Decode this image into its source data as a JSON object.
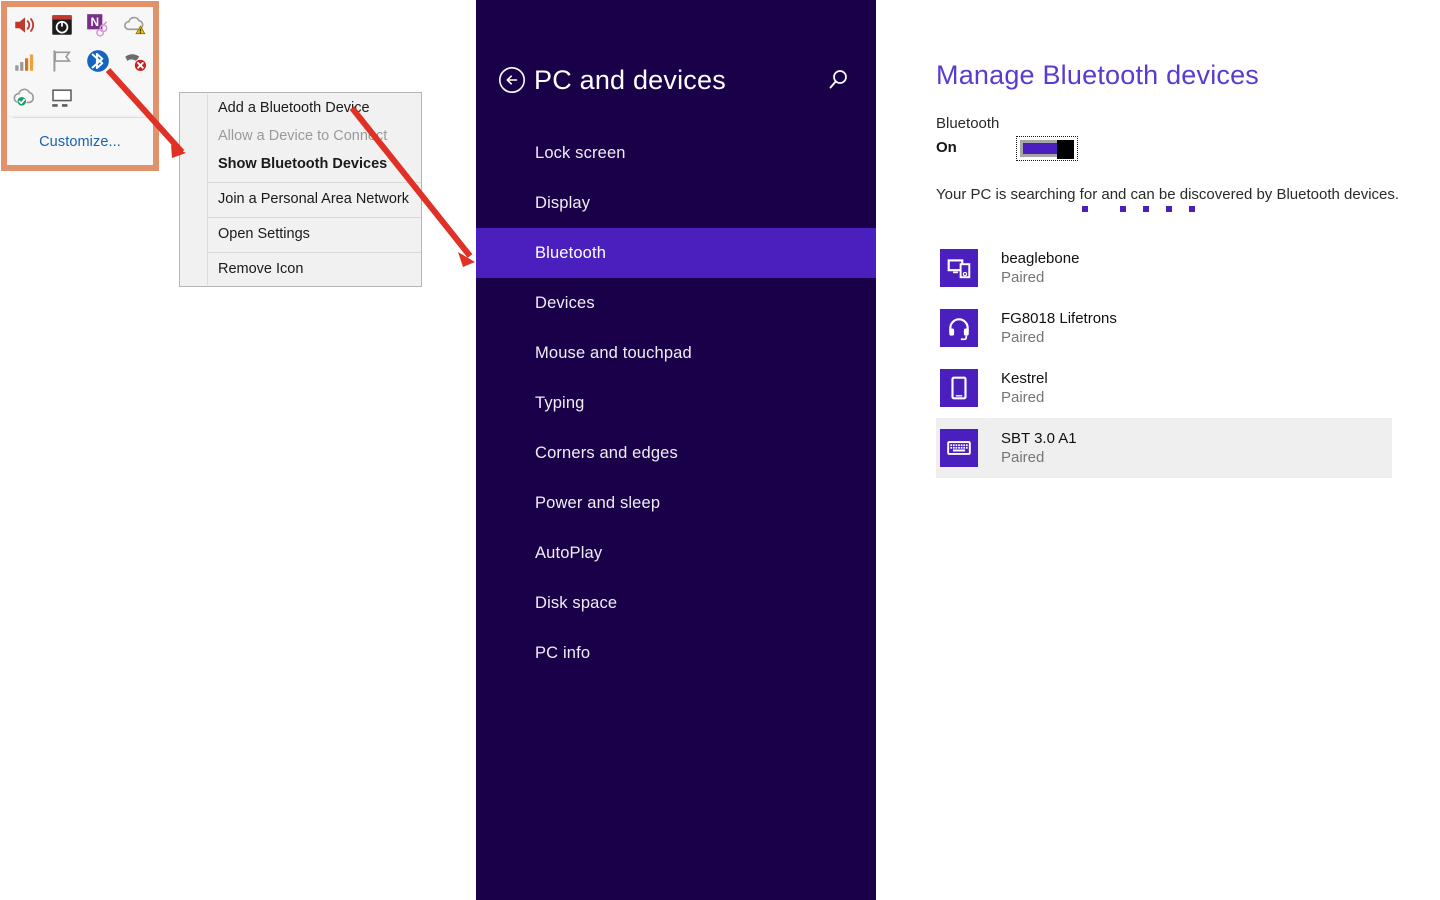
{
  "tray": {
    "icons": [
      {
        "name": "volume-icon",
        "label": "Volume"
      },
      {
        "name": "safely-remove-hardware-icon",
        "label": "Safely Remove Hardware"
      },
      {
        "name": "onenote-icon",
        "label": "OneNote"
      },
      {
        "name": "cloud-warning-icon",
        "label": "Cloud sync warning"
      },
      {
        "name": "network-signal-icon",
        "label": "Network signal"
      },
      {
        "name": "flag-action-center-icon",
        "label": "Action Center"
      },
      {
        "name": "bluetooth-icon",
        "label": "Bluetooth"
      },
      {
        "name": "input-device-error-icon",
        "label": "Device error"
      },
      {
        "name": "cloud-ok-icon",
        "label": "Cloud sync OK"
      },
      {
        "name": "display-icon",
        "label": "Display"
      }
    ],
    "customize_label": "Customize..."
  },
  "context_menu": {
    "groups": [
      {
        "items": [
          {
            "label": "Add a Bluetooth Device",
            "state": "normal",
            "name": "menu-item-add-a-bluetooth-device"
          },
          {
            "label": "Allow a Device to Connect",
            "state": "disabled",
            "name": "menu-item-allow-a-device-to-connect"
          },
          {
            "label": "Show Bluetooth Devices",
            "state": "bold",
            "name": "menu-item-show-bluetooth-devices"
          }
        ]
      },
      {
        "items": [
          {
            "label": "Join a Personal Area Network",
            "state": "normal",
            "name": "menu-item-join-a-personal-area-network"
          }
        ]
      },
      {
        "items": [
          {
            "label": "Open Settings",
            "state": "normal",
            "name": "menu-item-open-settings"
          }
        ]
      },
      {
        "items": [
          {
            "label": "Remove Icon",
            "state": "normal",
            "name": "menu-item-remove-icon"
          }
        ]
      }
    ]
  },
  "pc_devices": {
    "title": "PC and devices",
    "back_icon": "back-arrow-icon",
    "search_icon": "search-icon",
    "nav_items": [
      {
        "label": "Lock screen",
        "selected": false
      },
      {
        "label": "Display",
        "selected": false
      },
      {
        "label": "Bluetooth",
        "selected": true
      },
      {
        "label": "Devices",
        "selected": false
      },
      {
        "label": "Mouse and touchpad",
        "selected": false
      },
      {
        "label": "Typing",
        "selected": false
      },
      {
        "label": "Corners and edges",
        "selected": false
      },
      {
        "label": "Power and sleep",
        "selected": false
      },
      {
        "label": "AutoPlay",
        "selected": false
      },
      {
        "label": "Disk space",
        "selected": false
      },
      {
        "label": "PC info",
        "selected": false
      }
    ]
  },
  "bluetooth": {
    "title": "Manage Bluetooth devices",
    "toggle_label": "Bluetooth",
    "toggle_state": "On",
    "status_text": "Your PC is searching for and can be discovered by Bluetooth devices.",
    "devices": [
      {
        "name": "beaglebone",
        "status": "Paired",
        "icon": "devices-icon",
        "selected": false
      },
      {
        "name": "FG8018 Lifetrons",
        "status": "Paired",
        "icon": "headset-icon",
        "selected": false
      },
      {
        "name": "Kestrel",
        "status": "Paired",
        "icon": "phone-icon",
        "selected": false
      },
      {
        "name": "SBT 3.0 A1",
        "status": "Paired",
        "icon": "keyboard-icon",
        "selected": true
      }
    ]
  },
  "colors": {
    "accent_purple": "#4a1fbe",
    "panel_dark": "#1a0049",
    "title_purple": "#5a3bd0",
    "annotation_red": "#e03127",
    "tray_border_orange": "#e2926b",
    "link_blue": "#1763b0"
  }
}
